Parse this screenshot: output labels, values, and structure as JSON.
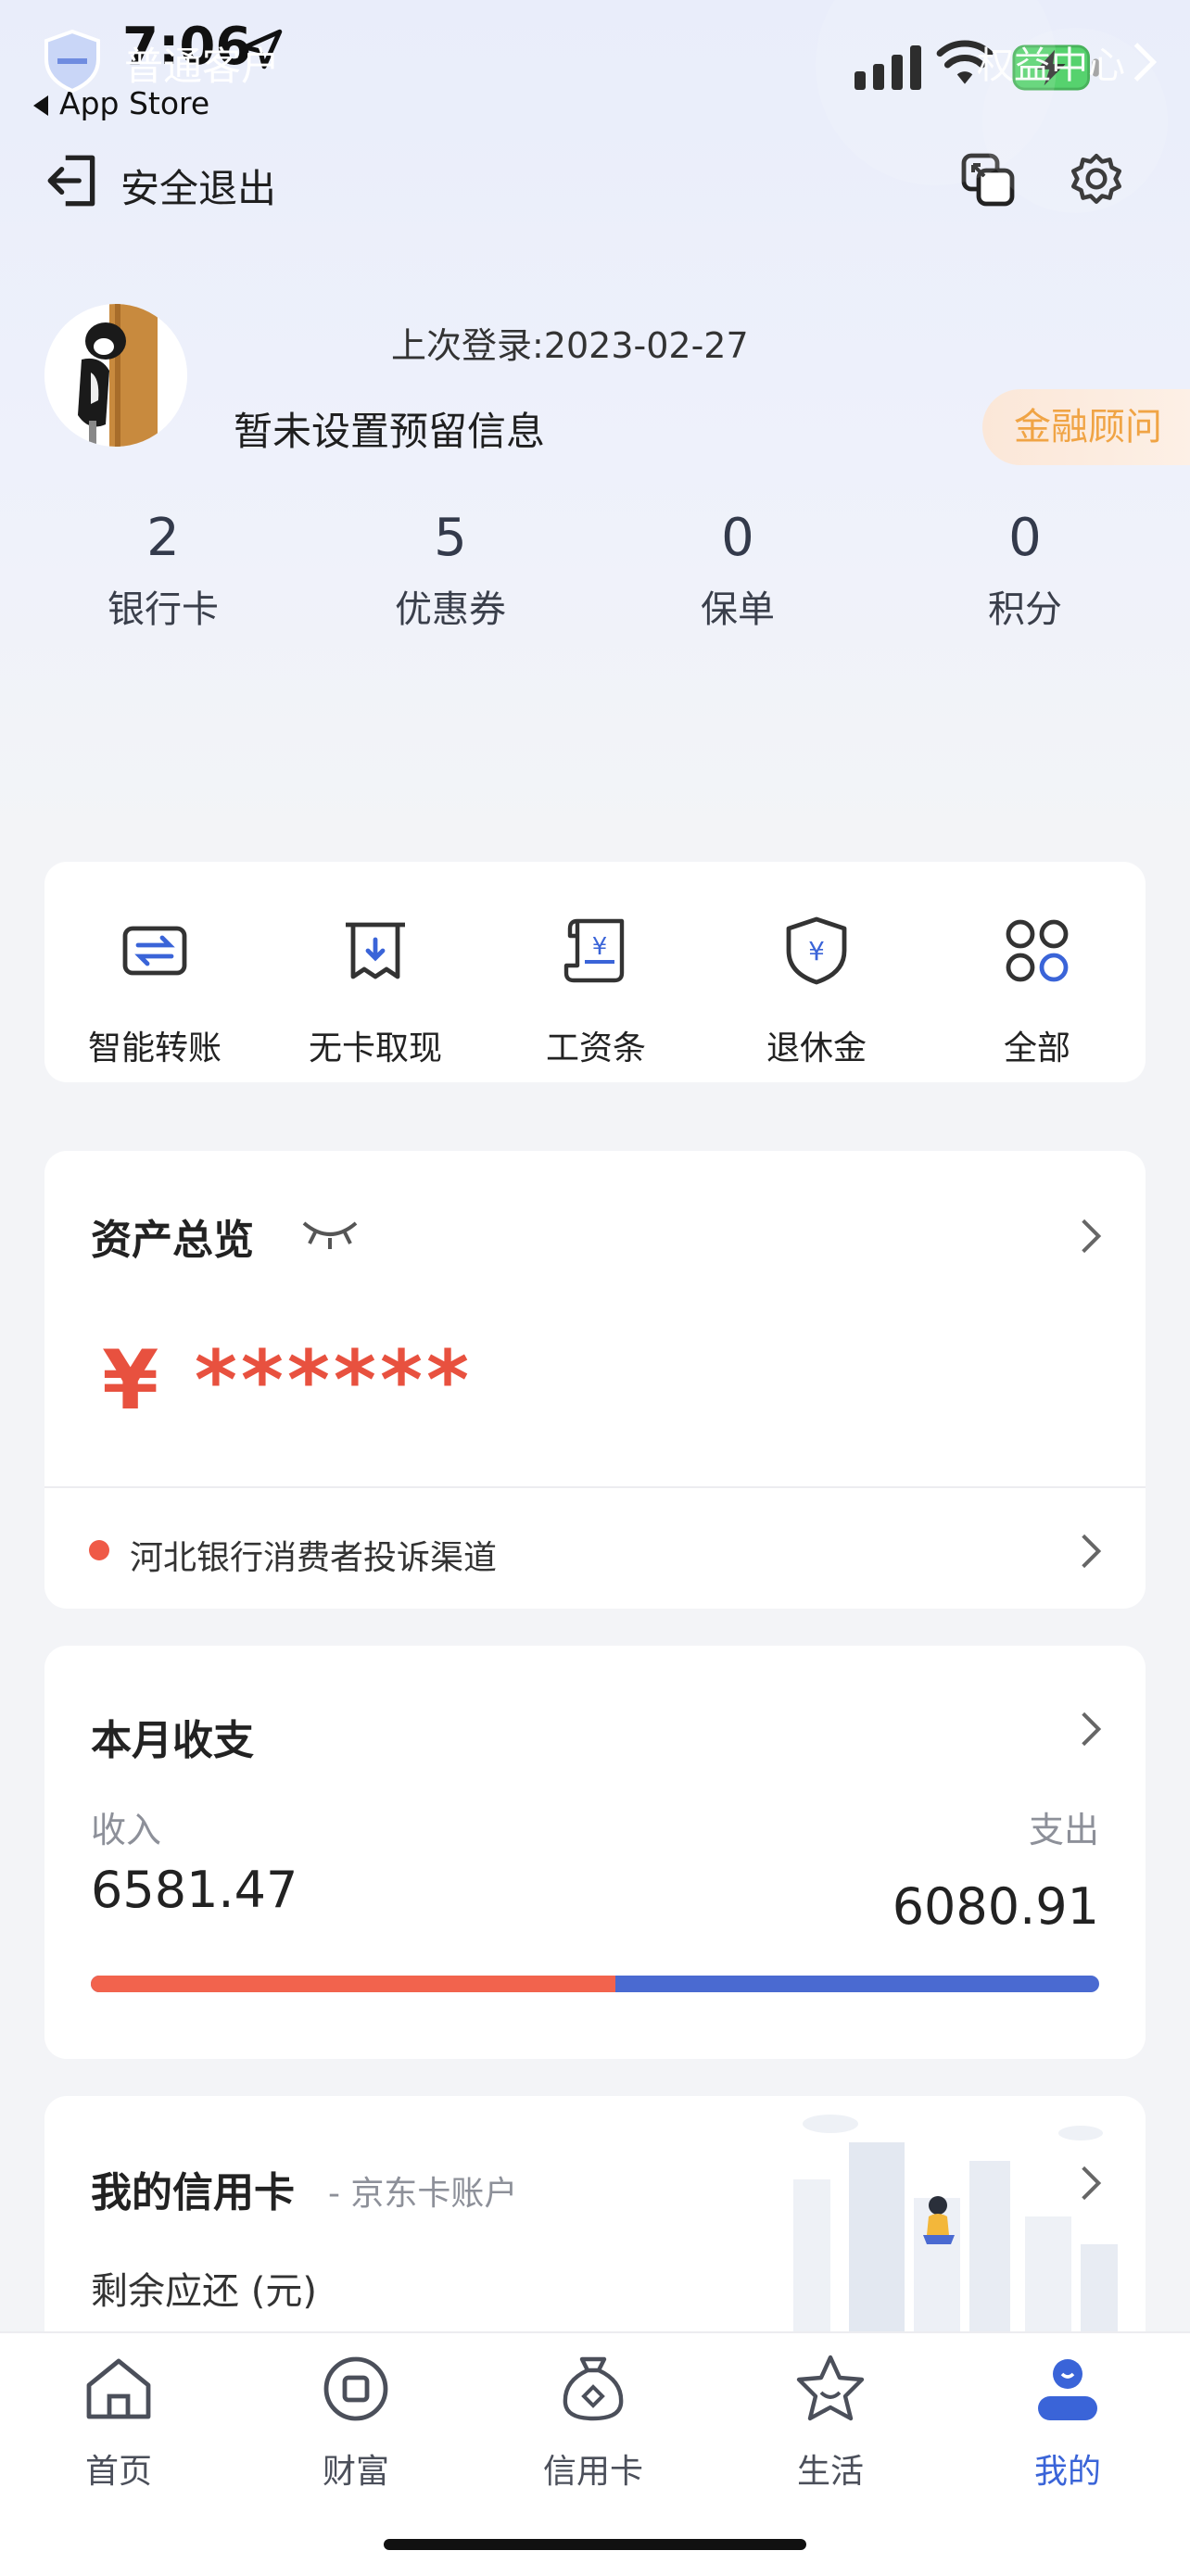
{
  "status_bar": {
    "time": "7:06",
    "back_label": "App Store"
  },
  "header": {
    "logout_label": "安全退出"
  },
  "profile": {
    "last_login": "上次登录:2023-02-27",
    "info_text": "暂未设置预留信息",
    "advisor_label": "金融顾问"
  },
  "stats": [
    {
      "value": "2",
      "label": "银行卡"
    },
    {
      "value": "5",
      "label": "优惠券"
    },
    {
      "value": "0",
      "label": "保单"
    },
    {
      "value": "0",
      "label": "积分"
    }
  ],
  "member": {
    "level": "普通客户",
    "rights_label": "权益中心"
  },
  "quick_actions": [
    {
      "label": "智能转账",
      "icon": "transfer-icon"
    },
    {
      "label": "无卡取现",
      "icon": "cardless-cash-icon"
    },
    {
      "label": "工资条",
      "icon": "payslip-icon"
    },
    {
      "label": "退休金",
      "icon": "pension-icon"
    },
    {
      "label": "全部",
      "icon": "all-apps-icon"
    }
  ],
  "assets": {
    "title": "资产总览",
    "amount": "¥ ******",
    "complaint_link": "河北银行消费者投诉渠道"
  },
  "monthly": {
    "title": "本月收支",
    "income_label": "收入",
    "income_value": "6581.47",
    "expense_label": "支出",
    "expense_value": "6080.91"
  },
  "credit_card": {
    "title": "我的信用卡",
    "subtitle": "- 京东卡账户",
    "remaining_label": "剩余应还 (元)"
  },
  "tabbar": [
    {
      "label": "首页",
      "icon": "home-icon"
    },
    {
      "label": "财富",
      "icon": "wealth-icon"
    },
    {
      "label": "信用卡",
      "icon": "credit-bag-icon"
    },
    {
      "label": "生活",
      "icon": "star-icon"
    },
    {
      "label": "我的",
      "icon": "profile-icon",
      "active": true
    }
  ],
  "colors": {
    "accent": "#3a64d8",
    "income": "#f2634d",
    "expense": "#4a6ad1",
    "advisor": "#f0a445",
    "amount": "#e8513f"
  }
}
